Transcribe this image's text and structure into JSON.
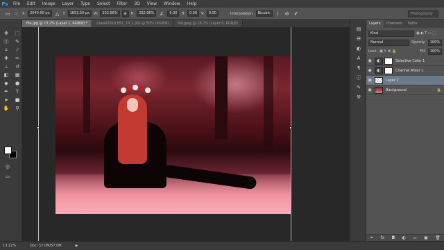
{
  "app": {
    "logo": "Ps"
  },
  "menu": [
    "File",
    "Edit",
    "Image",
    "Layer",
    "Type",
    "Select",
    "Filter",
    "3D",
    "View",
    "Window",
    "Help"
  ],
  "options": {
    "x_label": "X:",
    "x_value": "2040.50 px",
    "y_label": "Y:",
    "y_value": "1653.50 px",
    "w_label": "W:",
    "w_value": "202.66%",
    "h_label": "H:",
    "h_value": "202.66%",
    "angle_value": "0.00",
    "hskew_label": "H:",
    "hskew_value": "0.00",
    "vskew_label": "V:",
    "vskew_value": "0.00",
    "interp_label": "Interpolation:",
    "interp_value": "Bicubic",
    "workspace": "Photography"
  },
  "tabs": [
    {
      "label": "file.jpg @ 13.2% (Layer 1, RGB/8) *",
      "active": true
    },
    {
      "label": "Diwali2010 851_19_1.JPG @ 50% (RGB/8)",
      "active": false
    },
    {
      "label": "file.jpeg @ 16.7% (Layer 0, RGB/8)",
      "active": false
    }
  ],
  "layers_panel": {
    "tabs": [
      "Layers",
      "Channels",
      "Paths"
    ],
    "search_placeholder": "Kind",
    "blend_mode": "Normal",
    "opacity_label": "Opacity:",
    "opacity_value": "100%",
    "lock_label": "Lock:",
    "fill_label": "Fill:",
    "fill_value": "100%",
    "layers": [
      {
        "name": "Selective Color 1",
        "type": "adjustment",
        "selected": false
      },
      {
        "name": "Channel Mixer 1",
        "type": "adjustment",
        "selected": false
      },
      {
        "name": "Layer 1",
        "type": "pixel",
        "selected": true
      },
      {
        "name": "Background",
        "type": "background",
        "selected": false
      }
    ]
  },
  "status": {
    "zoom": "13.22%",
    "doc": "Doc: 57.0M/57.0M"
  }
}
